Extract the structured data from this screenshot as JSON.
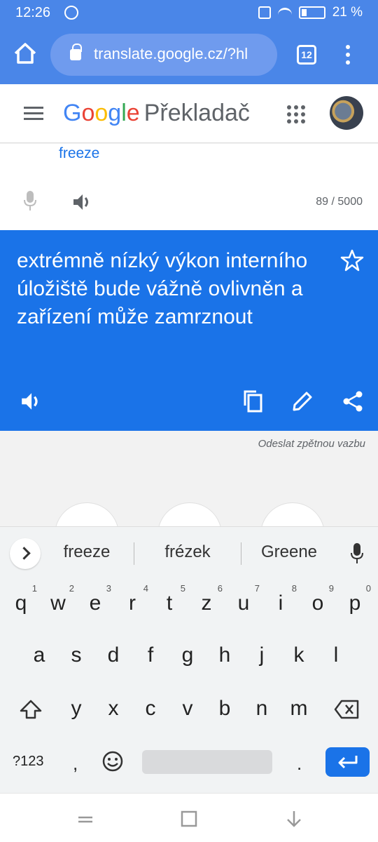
{
  "status": {
    "time": "12:26",
    "battery": "21 %"
  },
  "browser": {
    "url": "translate.google.cz/?hl",
    "tab_count": "12"
  },
  "header": {
    "logo_letters": [
      "G",
      "o",
      "o",
      "g",
      "l",
      "e"
    ],
    "product": "Překladač"
  },
  "input": {
    "suggestion": "freeze",
    "char_count": "89 / 5000"
  },
  "result": {
    "text": "extrémně nízký výkon interního úložiště bude vážně ovlivněn a zařízení může zamrznout"
  },
  "feedback": "Odeslat zpětnou vazbu",
  "keyboard": {
    "suggestions": [
      "freeze",
      "frézek",
      "Greene"
    ],
    "row1": [
      {
        "k": "q",
        "n": "1"
      },
      {
        "k": "w",
        "n": "2"
      },
      {
        "k": "e",
        "n": "3"
      },
      {
        "k": "r",
        "n": "4"
      },
      {
        "k": "t",
        "n": "5"
      },
      {
        "k": "z",
        "n": "6"
      },
      {
        "k": "u",
        "n": "7"
      },
      {
        "k": "i",
        "n": "8"
      },
      {
        "k": "o",
        "n": "9"
      },
      {
        "k": "p",
        "n": "0"
      }
    ],
    "row2": [
      "a",
      "s",
      "d",
      "f",
      "g",
      "h",
      "j",
      "k",
      "l"
    ],
    "row3": [
      "y",
      "x",
      "c",
      "v",
      "b",
      "n",
      "m"
    ],
    "symbols_key": "?123",
    "comma_key": ",",
    "period_key": "."
  },
  "colors": {
    "accent": "#1a73e8",
    "toolbar": "#4a86e8"
  }
}
